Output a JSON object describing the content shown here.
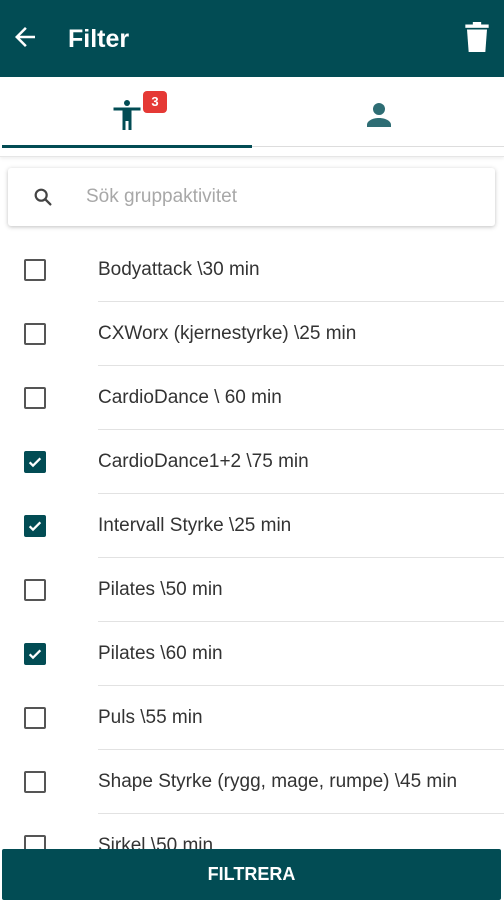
{
  "appbar": {
    "title": "Filter",
    "back_icon": "arrow-left-icon",
    "trash_icon": "trash-icon",
    "background": "#024c54"
  },
  "tabs": [
    {
      "icon": "person-activity-icon",
      "badge": "3",
      "selected": true
    },
    {
      "icon": "person-icon",
      "selected": false
    }
  ],
  "search": {
    "placeholder": "Sök gruppaktivitet",
    "value": "",
    "icon": "search-icon"
  },
  "items": [
    {
      "label": "Bodyattack \\30 min",
      "checked": false
    },
    {
      "label": "CXWorx (kjernestyrke) \\25 min",
      "checked": false
    },
    {
      "label": "CardioDance \\ 60 min",
      "checked": false
    },
    {
      "label": "CardioDance1+2 \\75 min",
      "checked": true
    },
    {
      "label": "Intervall Styrke \\25 min",
      "checked": true
    },
    {
      "label": "Pilates \\50 min",
      "checked": false
    },
    {
      "label": "Pilates \\60 min",
      "checked": true
    },
    {
      "label": "Puls \\55 min",
      "checked": false
    },
    {
      "label": "Shape Styrke (rygg, mage, rumpe) \\45 min",
      "checked": false
    },
    {
      "label": "Sirkel \\50 min",
      "checked": false
    }
  ],
  "button": {
    "label": "FILTRERA"
  },
  "colors": {
    "accent": "#024c54",
    "badge": "#e53935"
  }
}
